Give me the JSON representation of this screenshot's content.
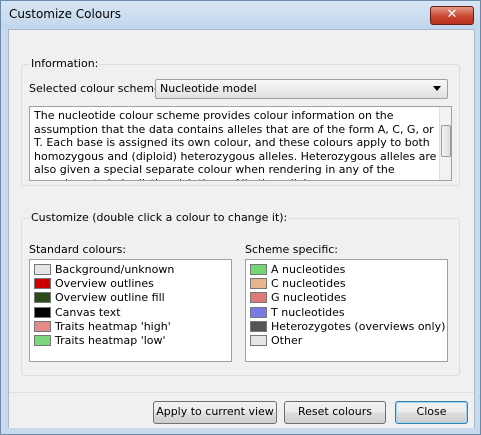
{
  "window": {
    "title": "Customize Colours",
    "close_glyph": "✕"
  },
  "information": {
    "group_label": "Information:",
    "scheme_label": "Selected colour scheme:",
    "scheme_value": "Nucleotide model",
    "description": "The nucleotide colour scheme provides colour information on the assumption that the data contains alleles that are of the form A, C, G, or T. Each base is assigned its own colour, and these colours apply to both homozygous and (diploid) heterozygous alleles. Heterozygous alleles are also given a special separate colour when rendering in any of the overviews to help distinguish them. All other alleles"
  },
  "customize": {
    "group_label": "Customize (double click a colour to change it):",
    "standard_label": "Standard colours:",
    "scheme_label": "Scheme specific:",
    "standard_items": [
      {
        "label": "Background/unknown",
        "color": "#e6e6e6"
      },
      {
        "label": "Overview outlines",
        "color": "#cc0000"
      },
      {
        "label": "Overview outline fill",
        "color": "#2a4a1a"
      },
      {
        "label": "Canvas text",
        "color": "#000000"
      },
      {
        "label": "Traits heatmap 'high'",
        "color": "#e58a8a"
      },
      {
        "label": "Traits heatmap 'low'",
        "color": "#7ad87a"
      }
    ],
    "scheme_items": [
      {
        "label": "A nucleotides",
        "color": "#72d672"
      },
      {
        "label": "C nucleotides",
        "color": "#e8b48a"
      },
      {
        "label": "G nucleotides",
        "color": "#e07a7a"
      },
      {
        "label": "T nucleotides",
        "color": "#7a7ae6"
      },
      {
        "label": "Heterozygotes (overviews only)",
        "color": "#555555"
      },
      {
        "label": "Other",
        "color": "#e6e6e6"
      }
    ]
  },
  "buttons": {
    "apply": "Apply to current view",
    "reset": "Reset colours",
    "close": "Close"
  }
}
